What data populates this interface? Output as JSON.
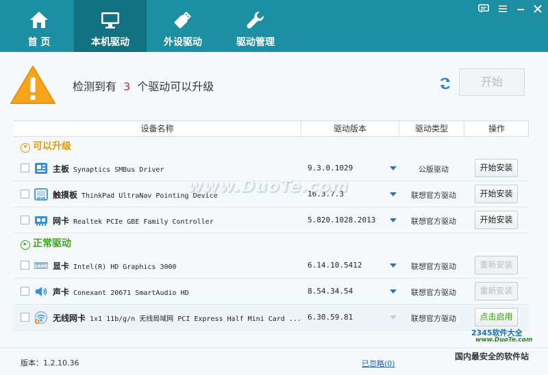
{
  "nav": {
    "tabs": [
      {
        "label": "首 页",
        "icon": "home-icon"
      },
      {
        "label": "本机驱动",
        "icon": "monitor-icon"
      },
      {
        "label": "外设驱动",
        "icon": "usb-icon"
      },
      {
        "label": "驱动管理",
        "icon": "wrench-icon"
      }
    ],
    "active_tab": "本机驱动"
  },
  "window_controls": [
    "feedback-icon",
    "menu-icon",
    "minimize-icon",
    "close-icon"
  ],
  "alert": {
    "prefix": "检测到有",
    "count": "3",
    "suffix": "个驱动可以升级",
    "start_button": "开始"
  },
  "table": {
    "headers": [
      "设备名称",
      "驱动版本",
      "驱动类型",
      "操作"
    ]
  },
  "groups": {
    "upgradable": "可以升级",
    "normal": "正常驱动"
  },
  "upgradable_rows": [
    {
      "category": "主板",
      "model": "Synaptics SMBus Driver",
      "version": "9.3.0.1029",
      "type": "公版驱动",
      "action": "开始安装"
    },
    {
      "category": "触摸板",
      "model": "ThinkPad UltraNav Pointing Device",
      "version": "16.3.7.3",
      "type": "联想官方驱动",
      "action": "开始安装"
    },
    {
      "category": "网卡",
      "model": "Realtek PCIe GBE Family Controller",
      "version": "5.820.1028.2013",
      "type": "联想官方驱动",
      "action": "开始安装"
    }
  ],
  "normal_rows": [
    {
      "category": "显卡",
      "model": "Intel(R) HD Graphics 3000",
      "version": "6.14.10.5412",
      "type": "联想官方驱动",
      "action": "重新安装"
    },
    {
      "category": "声卡",
      "model": "Conexant 20671 SmartAudio HD",
      "version": "8.54.34.54",
      "type": "联想官方驱动",
      "action": "重新安装"
    },
    {
      "category": "无线网卡",
      "model": "1x1 11b/g/n 无线局域网 PCI Express Half Mini Card ...",
      "version": "6.30.59.81",
      "type": "联想官方驱动",
      "action": "点击启用"
    }
  ],
  "footer": {
    "version": "版本：1.2.10.36",
    "ignored": "已忽略(0)"
  },
  "watermark": "www.DuoTe.com",
  "logo": {
    "brand": "2345软件大全",
    "site": "www.DuoTe.com",
    "tagline": "国内最安全的软件站"
  },
  "colors": {
    "header_bg": "#1d8fa3",
    "active_tab_bg": "#137282",
    "upgradable_group": "#e59a0a",
    "normal_group": "#3fa51e",
    "count": "#e0271e",
    "link": "#2266bb"
  }
}
